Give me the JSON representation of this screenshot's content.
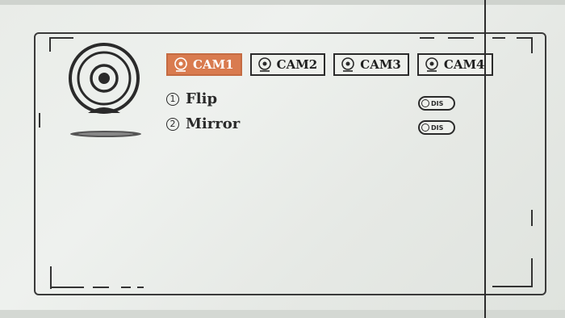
{
  "camera_tabs": [
    {
      "label": "CAM1",
      "active": true
    },
    {
      "label": "CAM2",
      "active": false
    },
    {
      "label": "CAM3",
      "active": false
    },
    {
      "label": "CAM4",
      "active": false
    }
  ],
  "options": [
    {
      "number": "1",
      "label": "Flip",
      "toggle_state": "DIS"
    },
    {
      "number": "2",
      "label": "Mirror",
      "toggle_state": "DIS"
    }
  ],
  "colors": {
    "active_tab": "#d97b4f",
    "frame": "#3a3a3a"
  }
}
